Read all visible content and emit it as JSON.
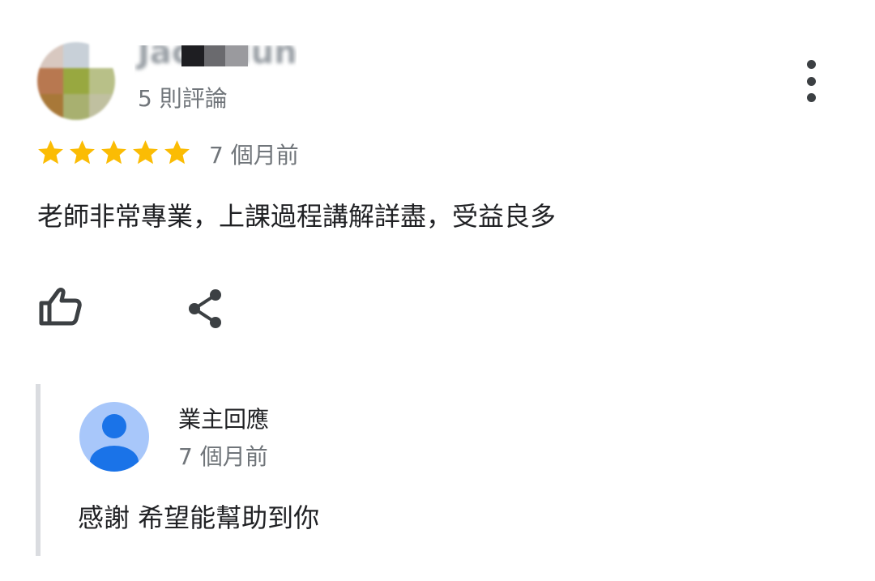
{
  "review": {
    "reviewer": {
      "name": "Jack Hung",
      "review_count": "5 則評論"
    },
    "rating": 5,
    "time": "7 個月前",
    "text": "老師非常專業，上課過程講解詳盡，受益良多",
    "actions": {
      "like_icon": "thumbs-up-icon",
      "share_icon": "share-icon",
      "more_icon": "more-vert-icon"
    },
    "owner_reply": {
      "label": "業主回應",
      "time": "7 個月前",
      "text": "感謝 希望能幫助到你"
    }
  },
  "colors": {
    "star": "#fbbc04",
    "primary_text": "#202124",
    "secondary_text": "#70757a",
    "icon": "#3c4043",
    "reply_bar": "#dadce0",
    "owner_avatar_bg": "#a8c7fa",
    "owner_avatar_fg": "#1a73e8"
  }
}
